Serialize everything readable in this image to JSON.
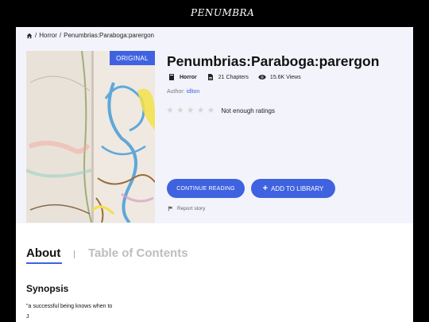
{
  "header": {
    "logo": "PENUMBRA"
  },
  "breadcrumb": {
    "sep1": "/",
    "category": "Horror",
    "sep2": "/",
    "current": "Penumbrias:Paraboga:parergon"
  },
  "book": {
    "badge": "ORIGINAL",
    "title": "Penumbrias:Paraboga:parergon",
    "genre": "Horror",
    "chapters": "21 Chapters",
    "views": "15.6K Views",
    "author_label": "Author:",
    "author": "idlton",
    "rating_text": "Not enough ratings",
    "rating_stars": 0,
    "rating_max": 5
  },
  "actions": {
    "continue": "CONTINUE READING",
    "add": "ADD TO LIBRARY",
    "add_icon": "+",
    "report": "Report story"
  },
  "tabs": {
    "about": "About",
    "toc": "Table of Contents"
  },
  "synopsis": {
    "title": "Synopsis",
    "body_line1": "\"a successful being knows when to",
    "body_line2": "J"
  },
  "colors": {
    "accent": "#3f63e0",
    "hero_bg": "#f3f4fb"
  }
}
